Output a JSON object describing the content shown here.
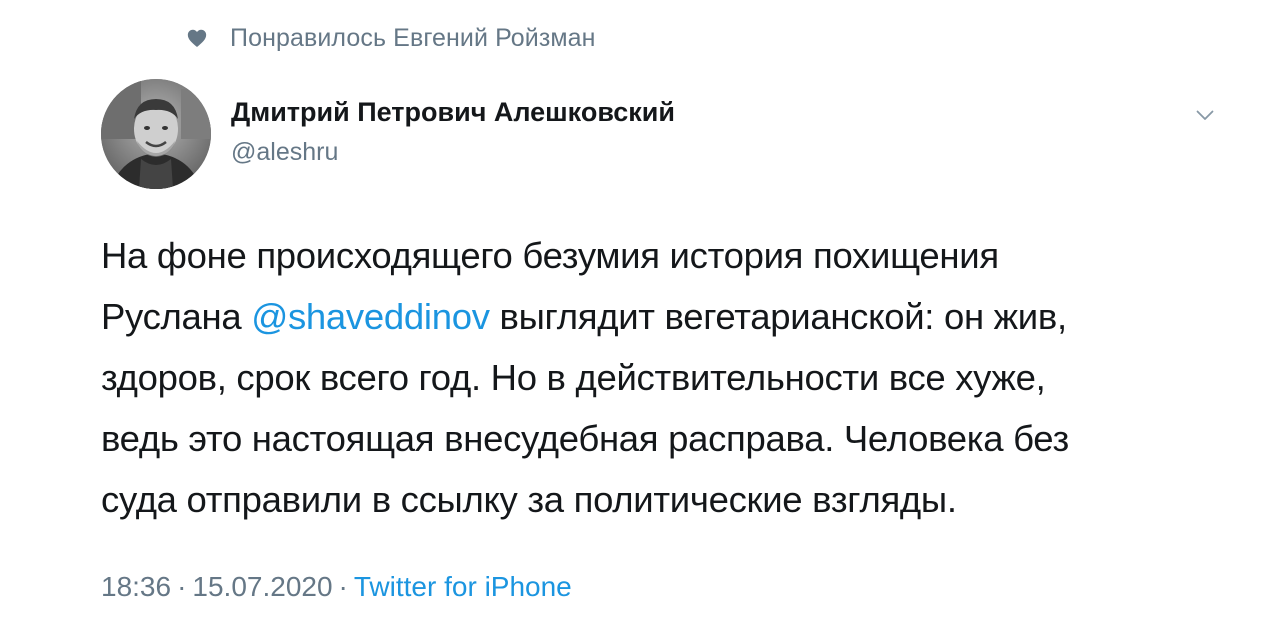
{
  "liked_by": {
    "icon": "heart-icon",
    "text": "Понравилось Евгений Ройзман"
  },
  "author": {
    "avatar_icon": "avatar",
    "name": "Дмитрий Петрович Алешковский",
    "handle": "@aleshru"
  },
  "menu": {
    "icon": "chevron-down-icon"
  },
  "tweet": {
    "line1": "На фоне происходящего безумия  история похищения",
    "line2_prefix": "Руслана ",
    "mention": "@shaveddinov",
    "line2_suffix": " выглядит вегетарианской: он жив,",
    "line3": "здоров, срок всего год. Но в действительности все хуже,",
    "line4": "ведь это настоящая внесудебная расправа. Человека без",
    "line5": "суда отправили в ссылку за политические взгляды."
  },
  "meta": {
    "time": "18:36",
    "separator": "·",
    "date": "15.07.2020",
    "source": "Twitter for iPhone"
  },
  "colors": {
    "link": "#1b95e0",
    "secondary_text": "#657786",
    "primary_text": "#14171a"
  }
}
